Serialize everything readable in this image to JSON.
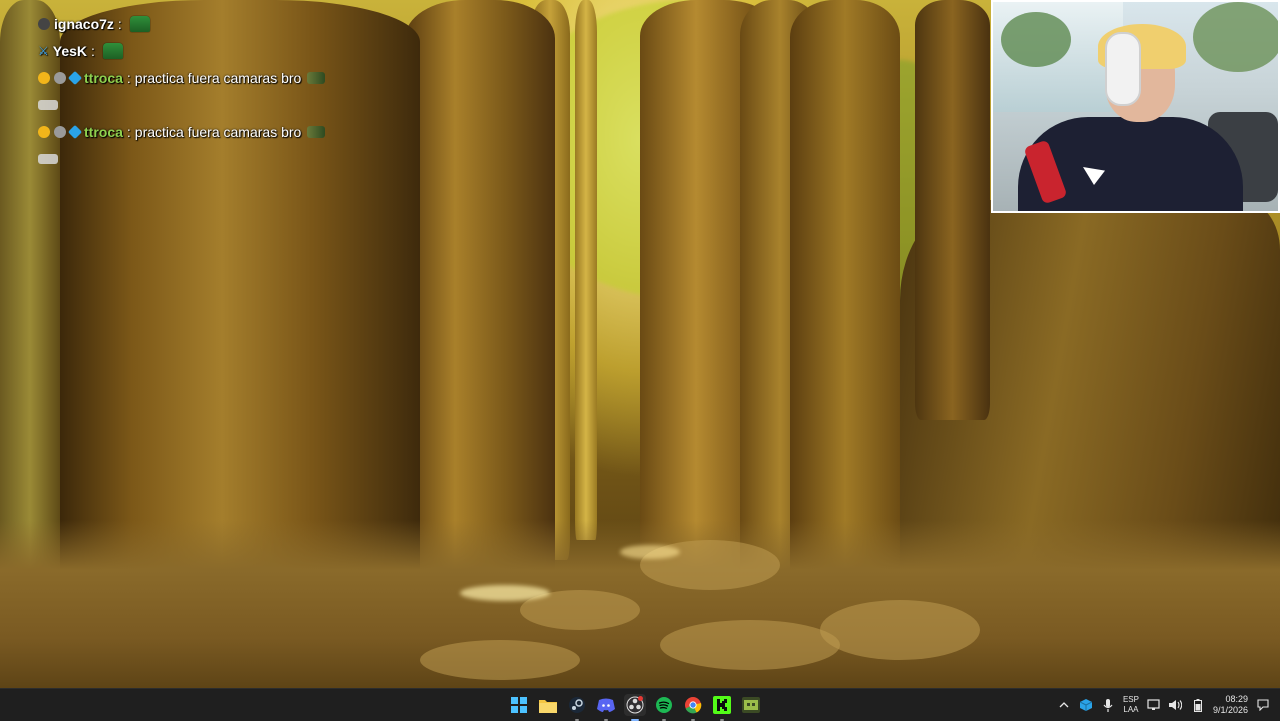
{
  "chat": {
    "messages": [
      {
        "user": "ignaco7z",
        "text": "",
        "badges": [
          "mod"
        ],
        "emotes": [
          "frog"
        ]
      },
      {
        "user": "YesK",
        "text": "",
        "badges": [
          "sword"
        ],
        "emotes": [
          "frog"
        ]
      },
      {
        "user": "ttroca",
        "text": "practica fuera camaras bro",
        "badges": [
          "gold",
          "grey",
          "cube"
        ],
        "emotes": [
          "small"
        ]
      },
      {
        "user": "",
        "text": "",
        "badges": [],
        "emotes": [
          "deleted"
        ]
      },
      {
        "user": "ttroca",
        "text": "practica fuera camaras bro",
        "badges": [
          "gold",
          "grey",
          "cube"
        ],
        "emotes": [
          "small"
        ]
      },
      {
        "user": "",
        "text": "",
        "badges": [],
        "emotes": [
          "deleted"
        ]
      }
    ],
    "separator": ":"
  },
  "taskbar": {
    "apps": [
      {
        "name": "start",
        "icon": "windows-icon",
        "color": "#4cc2ff",
        "state": "none"
      },
      {
        "name": "file-explorer",
        "icon": "folder-icon",
        "color": "#f4c542",
        "state": "none"
      },
      {
        "name": "steam",
        "icon": "steam-icon",
        "color": "#c7d5e0",
        "state": "running"
      },
      {
        "name": "discord",
        "icon": "discord-icon",
        "color": "#5865f2",
        "state": "running"
      },
      {
        "name": "obs",
        "icon": "obs-icon",
        "color": "#dcdcdc",
        "state": "active"
      },
      {
        "name": "spotify",
        "icon": "spotify-icon",
        "color": "#1db954",
        "state": "running"
      },
      {
        "name": "chrome",
        "icon": "chrome-icon",
        "color": "#ea4335",
        "state": "running"
      },
      {
        "name": "kick",
        "icon": "kick-icon",
        "color": "#53fc18",
        "state": "running"
      },
      {
        "name": "game",
        "icon": "game-icon",
        "color": "#9bbd4a",
        "state": "none"
      }
    ],
    "tray": {
      "language_top": "ESP",
      "language_bottom": "LAA",
      "time": "08:29",
      "date": "9/1/2026"
    }
  }
}
